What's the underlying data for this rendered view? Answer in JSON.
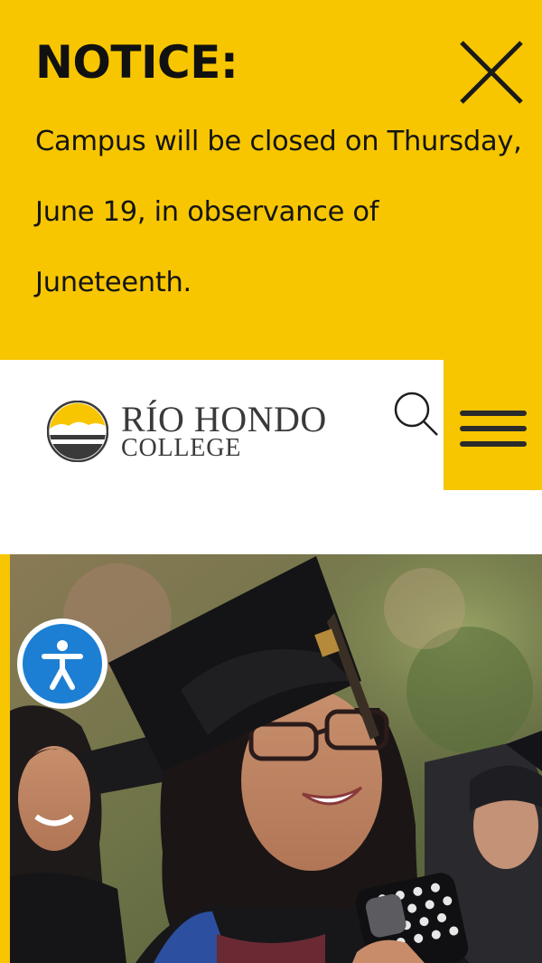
{
  "notice": {
    "title": "NOTICE:",
    "body": "Campus will be closed on Thursday, June 19, in observance of Juneteenth.",
    "close_icon": "close-icon"
  },
  "header": {
    "logo": {
      "line1": "RÍO HONDO",
      "line2": "COLLEGE"
    },
    "search_icon": "search-icon",
    "menu_icon": "hamburger-menu-icon"
  },
  "accessibility": {
    "icon": "accessibility-icon"
  },
  "hero": {
    "image": "graduation-photo"
  },
  "colors": {
    "accent": "#f7c600",
    "text": "#1c1c1c",
    "accessibility_blue": "#1d7fd3"
  }
}
